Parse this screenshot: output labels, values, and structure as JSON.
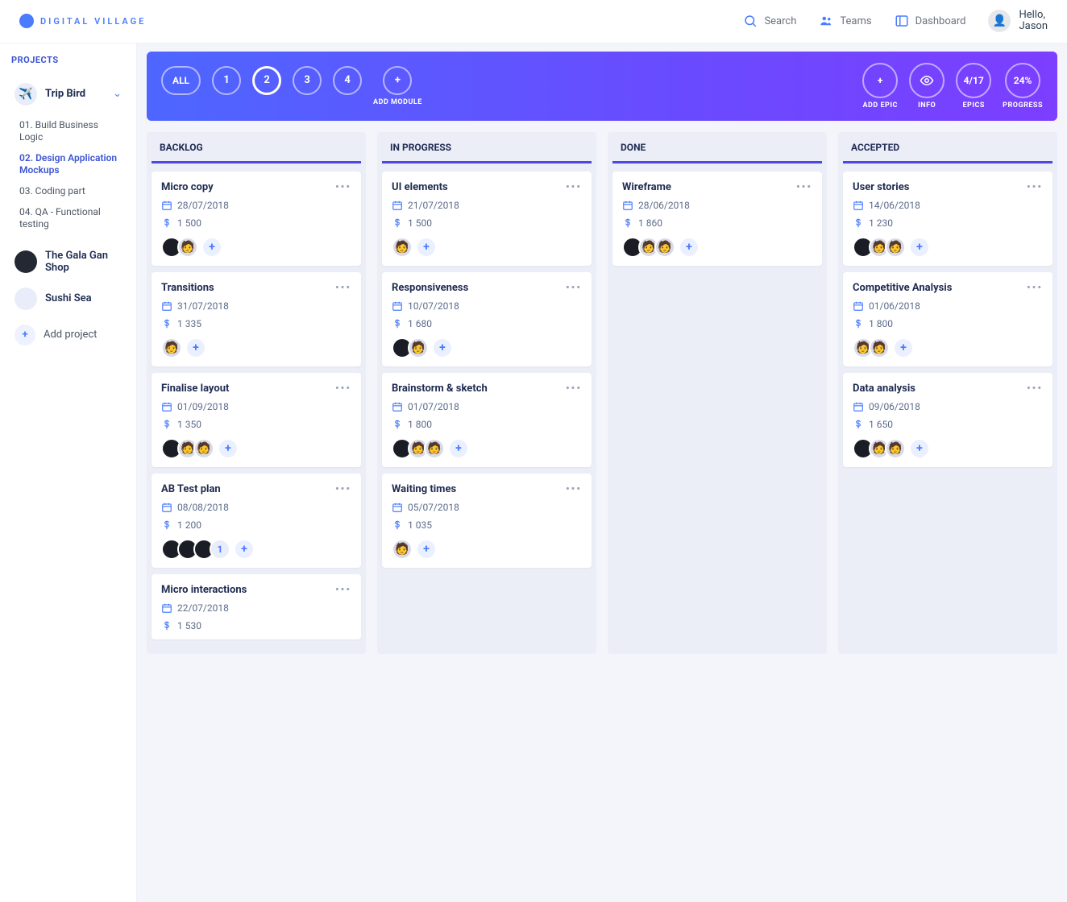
{
  "brand": "DIGITAL VILLAGE",
  "header": {
    "search": "Search",
    "teams": "Teams",
    "dashboard": "Dashboard",
    "greet_line1": "Hello,",
    "greet_line2": "Jason"
  },
  "sidebar": {
    "title": "PROJECTS",
    "projects": [
      {
        "name": "Trip Bird",
        "active": true,
        "items": [
          "01. Build Business Logic",
          "02. Design Application Mockups",
          "03. Coding part",
          "04. QA - Functional testing"
        ],
        "selected_index": 1
      },
      {
        "name": "The Gala Gan Shop"
      },
      {
        "name": "Sushi Sea"
      }
    ],
    "add_label": "Add project"
  },
  "module_bar": {
    "all": "ALL",
    "modules": [
      "1",
      "2",
      "3",
      "4"
    ],
    "active_index": 1,
    "add_module_label": "ADD MODULE",
    "right": [
      {
        "icon": "plus",
        "label": "ADD EPIC"
      },
      {
        "icon": "eye",
        "label": "INFO"
      },
      {
        "text": "4/17",
        "label": "EPICS"
      },
      {
        "text": "24%",
        "label": "PROGRESS"
      }
    ]
  },
  "columns": [
    {
      "title": "BACKLOG",
      "cards": [
        {
          "title": "Micro copy",
          "date": "28/07/2018",
          "price": "1 500",
          "avatars": [
            "dark",
            "light"
          ]
        },
        {
          "title": "Transitions",
          "date": "31/07/2018",
          "price": "1 335",
          "avatars": [
            "light"
          ]
        },
        {
          "title": "Finalise layout",
          "date": "01/09/2018",
          "price": "1 350",
          "avatars": [
            "dark",
            "light",
            "light"
          ]
        },
        {
          "title": "AB Test plan",
          "date": "08/08/2018",
          "price": "1 200",
          "avatars": [
            "dark",
            "dark",
            "dark"
          ],
          "extra_count": "1"
        },
        {
          "title": "Micro interactions",
          "date": "22/07/2018",
          "price": "1 530"
        }
      ]
    },
    {
      "title": "IN PROGRESS",
      "cards": [
        {
          "title": "UI elements",
          "date": "21/07/2018",
          "price": "1 500",
          "avatars": [
            "light"
          ]
        },
        {
          "title": "Responsiveness",
          "date": "10/07/2018",
          "price": "1 680",
          "avatars": [
            "dark",
            "light"
          ]
        },
        {
          "title": "Brainstorm & sketch",
          "date": "01/07/2018",
          "price": "1 800",
          "avatars": [
            "dark",
            "light",
            "light"
          ]
        },
        {
          "title": "Waiting times",
          "date": "05/07/2018",
          "price": "1 035",
          "avatars": [
            "light"
          ]
        }
      ]
    },
    {
      "title": "DONE",
      "cards": [
        {
          "title": "Wireframe",
          "date": "28/06/2018",
          "price": "1 860",
          "avatars": [
            "dark",
            "light",
            "light"
          ]
        }
      ]
    },
    {
      "title": "ACCEPTED",
      "cards": [
        {
          "title": "User stories",
          "date": "14/06/2018",
          "price": "1 230",
          "avatars": [
            "dark",
            "light",
            "light"
          ]
        },
        {
          "title": "Competitive Analysis",
          "date": "01/06/2018",
          "price": "1 800",
          "avatars": [
            "light",
            "light"
          ]
        },
        {
          "title": "Data analysis",
          "date": "09/06/2018",
          "price": "1 650",
          "avatars": [
            "dark",
            "light",
            "light"
          ]
        }
      ]
    }
  ]
}
